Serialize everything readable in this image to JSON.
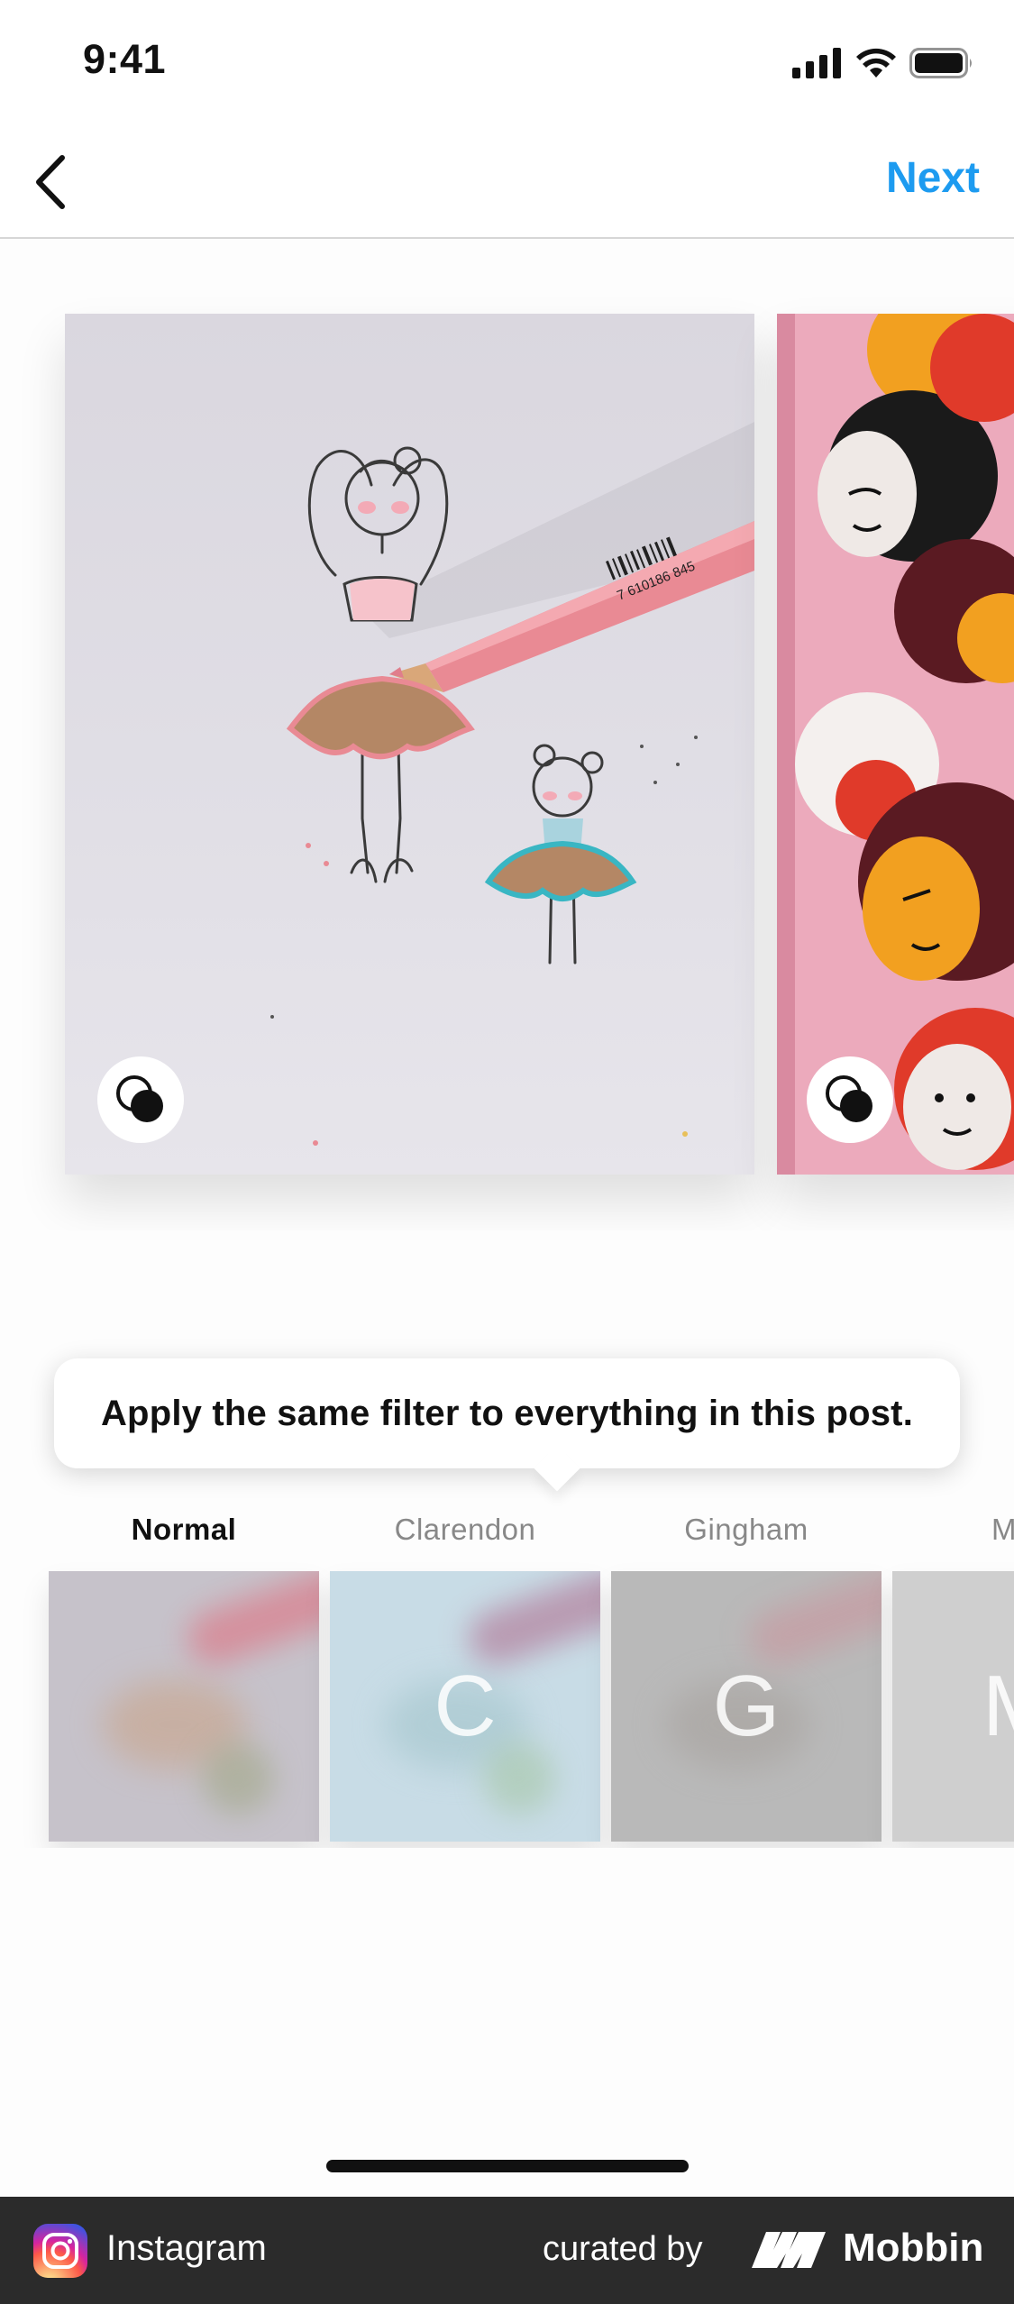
{
  "status_bar": {
    "time": "9:41",
    "icons": [
      "cellular-signal-icon",
      "wifi-icon",
      "battery-icon"
    ]
  },
  "nav": {
    "back_icon": "chevron-left-icon",
    "next_label": "Next",
    "next_color": "#1d9bf0"
  },
  "carousel": {
    "photos": [
      {
        "name": "ballerina-drawing-photo",
        "pencil_text": "7 610186 845"
      },
      {
        "name": "painted-faces-mural-photo"
      }
    ],
    "toggle_icon": "overlapping-circles-icon"
  },
  "tooltip": {
    "text": "Apply the same filter to everything in this post."
  },
  "filters": [
    {
      "label": "Normal",
      "letter": "",
      "selected": true
    },
    {
      "label": "Clarendon",
      "letter": "C",
      "selected": false
    },
    {
      "label": "Gingham",
      "letter": "G",
      "selected": false
    },
    {
      "label": "M",
      "letter": "M",
      "selected": false
    }
  ],
  "footer": {
    "app_name": "Instagram",
    "curated_label": "curated by",
    "brand": "Mobbin"
  }
}
